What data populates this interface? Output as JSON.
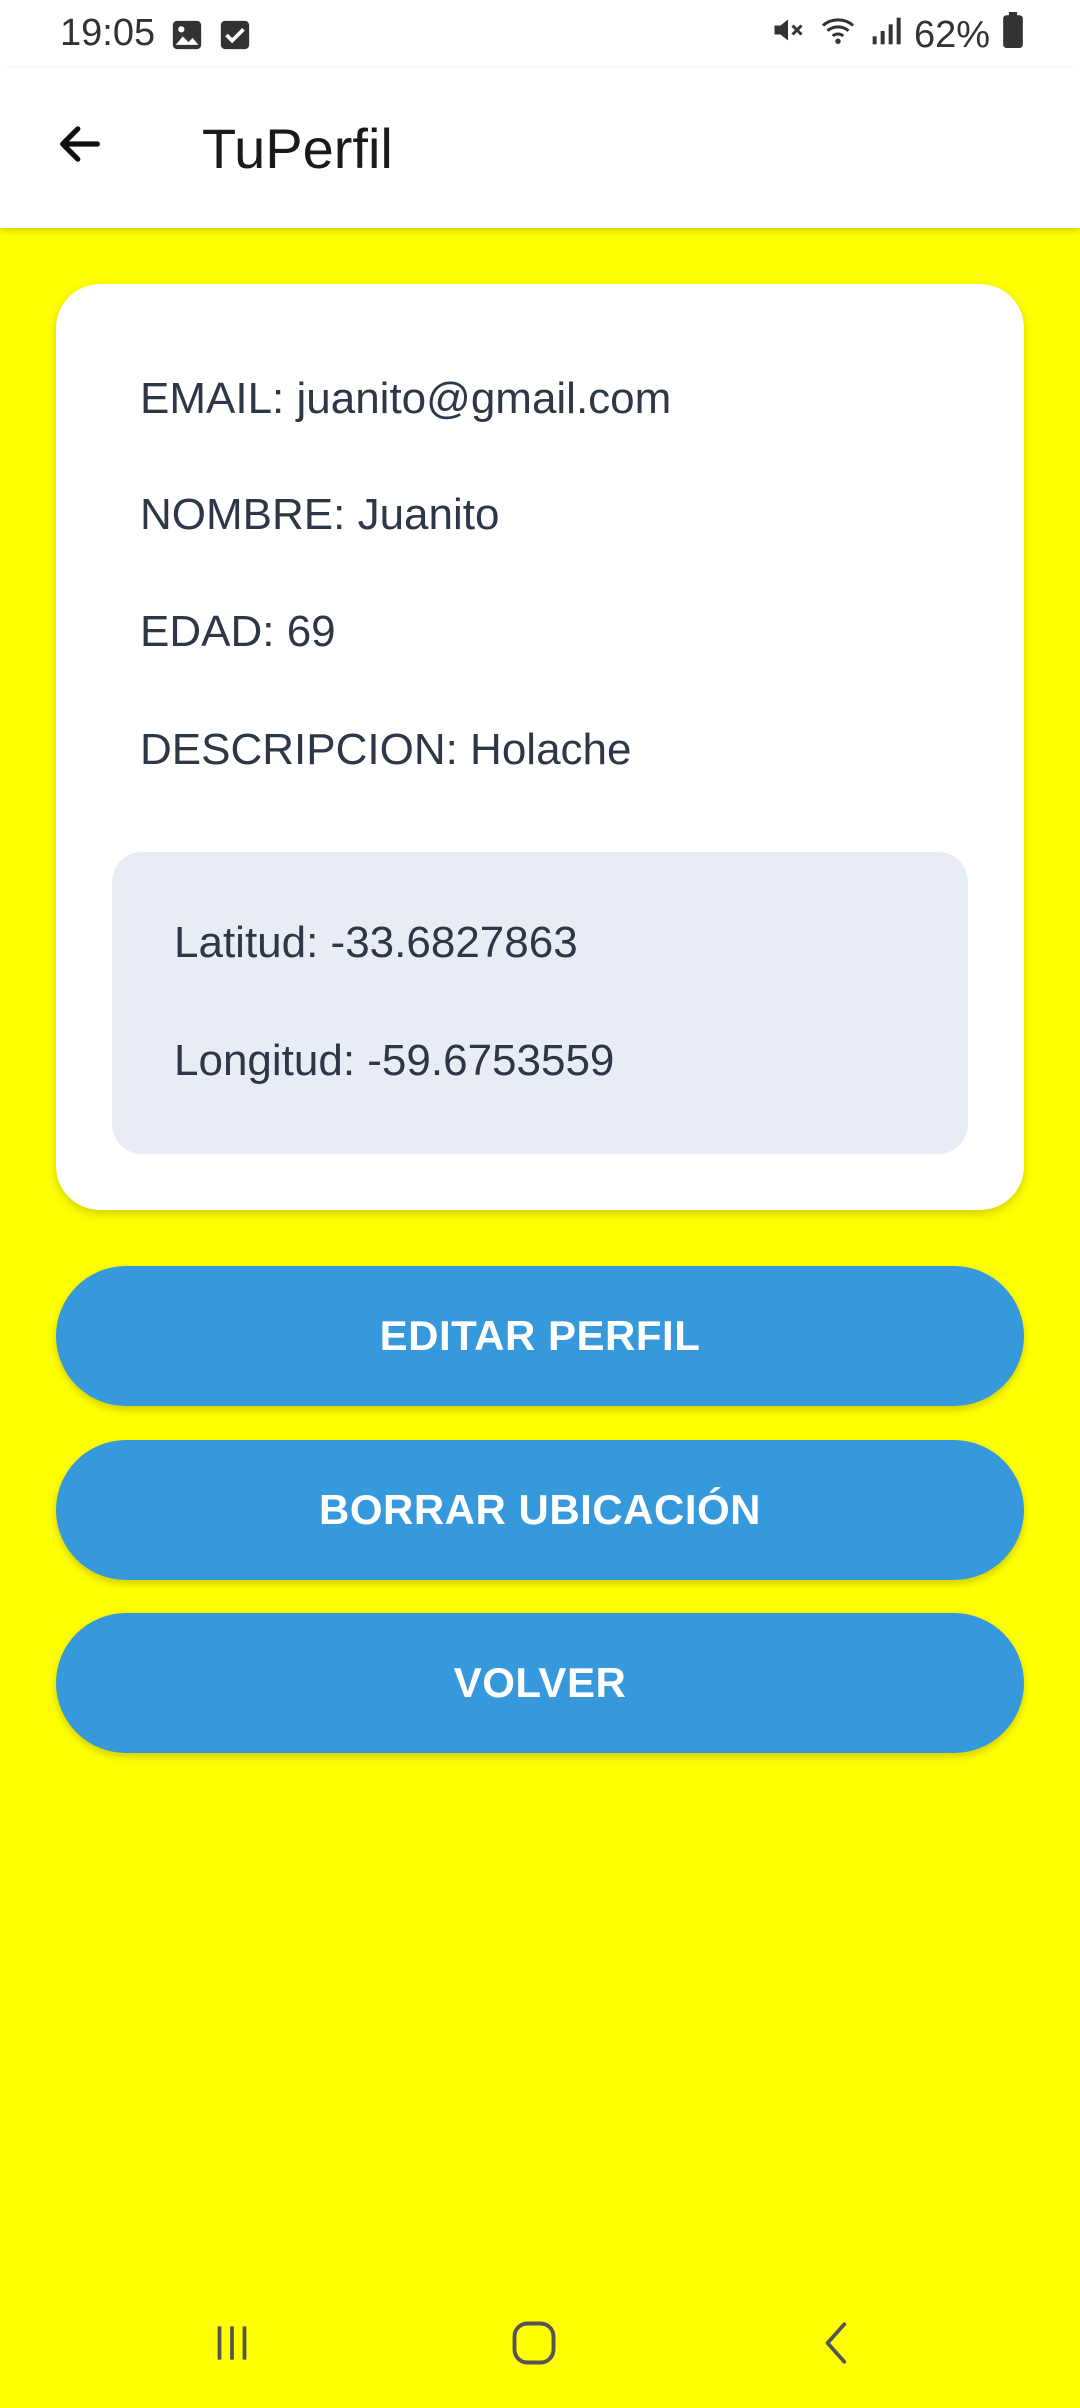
{
  "status_bar": {
    "time": "19:05",
    "battery": "62%",
    "icons": [
      "image-icon",
      "checkbox-icon",
      "mute-icon",
      "wifi-icon",
      "signal-icon",
      "battery-icon"
    ]
  },
  "app_bar": {
    "title": "TuPerfil",
    "back_icon": "arrow-left-icon"
  },
  "profile": {
    "email": "EMAIL: juanito@gmail.com",
    "nombre": "NOMBRE: Juanito",
    "edad": "EDAD: 69",
    "descripcion": "DESCRIPCION: Holache"
  },
  "location": {
    "latitud": "Latitud: -33.6827863",
    "longitud": "Longitud: -59.6753559"
  },
  "buttons": {
    "edit": "EDITAR PERFIL",
    "delete_location": "BORRAR UBICACIÓN",
    "back": "VOLVER"
  },
  "colors": {
    "background": "#ffff00",
    "button": "#3699db",
    "card": "#ffffff",
    "location_box": "#e8edf5",
    "text": "#2d3748"
  },
  "nav_bar": {
    "icons": [
      "recent-apps-icon",
      "home-icon",
      "back-icon"
    ]
  }
}
